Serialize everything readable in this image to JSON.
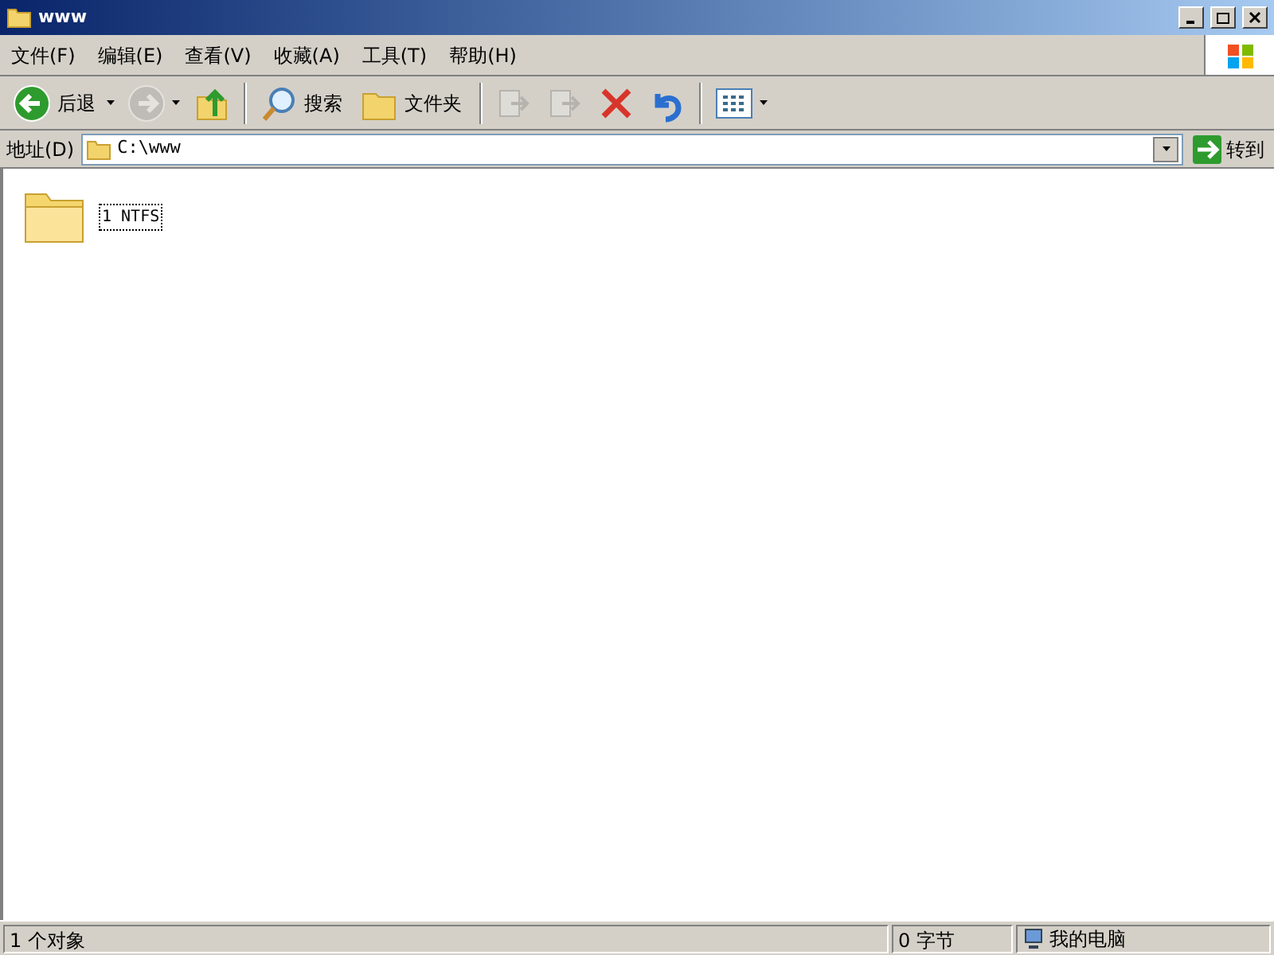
{
  "window": {
    "title": "www"
  },
  "menu": [
    "文件(F)",
    "编辑(E)",
    "查看(V)",
    "收藏(A)",
    "工具(T)",
    "帮助(H)"
  ],
  "toolbar": [
    {
      "kind": "back",
      "label": "后退",
      "disabled": false,
      "dropdown": true
    },
    {
      "kind": "forward",
      "disabled": true,
      "dropdown": true
    },
    {
      "kind": "up",
      "disabled": false
    },
    {
      "kind": "separator"
    },
    {
      "kind": "search",
      "label": "搜索",
      "disabled": false
    },
    {
      "kind": "folders",
      "label": "文件夹",
      "disabled": false
    },
    {
      "kind": "separator"
    },
    {
      "kind": "move",
      "disabled": true
    },
    {
      "kind": "copy",
      "disabled": true
    },
    {
      "kind": "delete",
      "disabled": false
    },
    {
      "kind": "undo",
      "disabled": false
    },
    {
      "kind": "separator"
    },
    {
      "kind": "views",
      "disabled": false,
      "dropdown": true
    }
  ],
  "address": {
    "label": "地址(D)",
    "value": "C:\\www",
    "go": "转到"
  },
  "items": [
    {
      "name": "1 NTFS",
      "selected": true
    }
  ],
  "status_bar": {
    "objects": "1 个对象",
    "size": "0 字节",
    "zone": "我的电脑"
  }
}
